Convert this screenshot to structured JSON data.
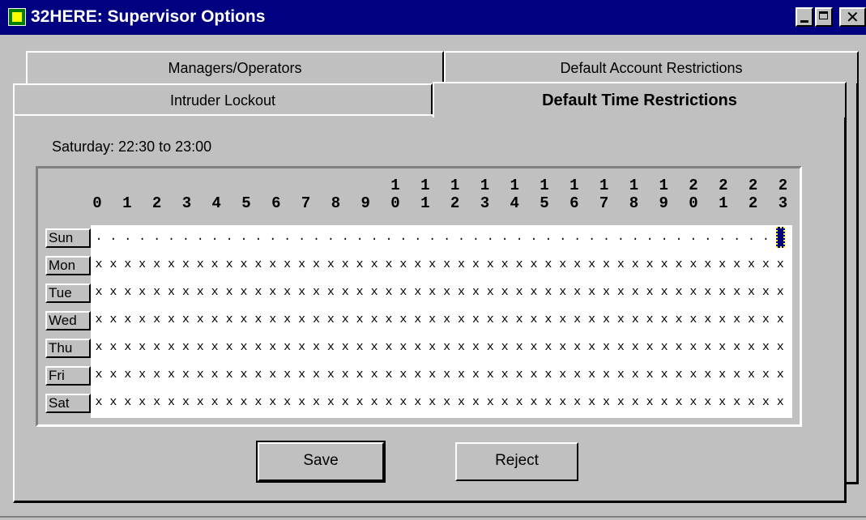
{
  "window": {
    "title": "32HERE: Supervisor Options"
  },
  "tabs": {
    "managers_operators": "Managers/Operators",
    "default_account_restrictions": "Default Account Restrictions",
    "intruder_lockout": "Intruder Lockout",
    "default_time_restrictions": "Default Time Restrictions"
  },
  "active_tab": "default_time_restrictions",
  "status_text": "Saturday: 22:30 to 23:00",
  "hours": [
    "0",
    "1",
    "2",
    "3",
    "4",
    "5",
    "6",
    "7",
    "8",
    "9",
    "10",
    "11",
    "12",
    "13",
    "14",
    "15",
    "16",
    "17",
    "18",
    "19",
    "20",
    "21",
    "22",
    "23"
  ],
  "days": [
    {
      "label": "Sun",
      "slots": "allowed"
    },
    {
      "label": "Mon",
      "slots": "restricted"
    },
    {
      "label": "Tue",
      "slots": "restricted"
    },
    {
      "label": "Wed",
      "slots": "restricted"
    },
    {
      "label": "Thu",
      "slots": "restricted"
    },
    {
      "label": "Fri",
      "slots": "restricted"
    },
    {
      "label": "Sat",
      "slots": "restricted"
    }
  ],
  "slot_marks": {
    "allowed": ".",
    "restricted": "x"
  },
  "selected_cell": {
    "day": "Sun",
    "slot": 47
  },
  "buttons": {
    "save": "Save",
    "reject": "Reject"
  },
  "colors": {
    "title_bar": "#000080",
    "face": "#c0c0c0",
    "selection": "#000080"
  }
}
